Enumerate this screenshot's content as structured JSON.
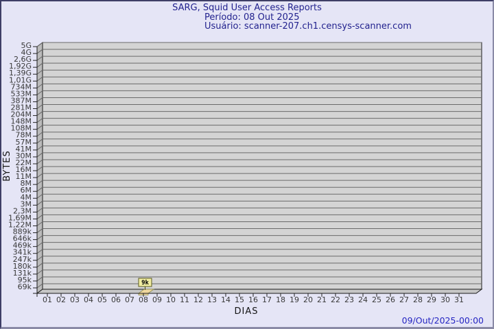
{
  "header": {
    "title": "SARG, Squid User Access Reports",
    "period": "Período: 08 Out 2025",
    "user": "Usuário: scanner-207.ch1.censys-scanner.com"
  },
  "footer": {
    "timestamp": "09/Out/2025-00:00"
  },
  "chart_data": {
    "type": "bar",
    "title": "SARG, Squid User Access Reports",
    "subtitle": "Período: 08 Out 2025 — Usuário: scanner-207.ch1.censys-scanner.com",
    "xlabel": "DIAS",
    "ylabel": "BYTES",
    "x_categories": [
      "01",
      "02",
      "03",
      "04",
      "05",
      "06",
      "07",
      "08",
      "09",
      "10",
      "11",
      "12",
      "13",
      "14",
      "15",
      "16",
      "17",
      "18",
      "19",
      "20",
      "21",
      "22",
      "23",
      "24",
      "25",
      "26",
      "27",
      "28",
      "29",
      "30",
      "31"
    ],
    "y_tick_labels": [
      "5G",
      "4G",
      "2,6G",
      "1,92G",
      "1,39G",
      "1,01G",
      "734M",
      "533M",
      "387M",
      "281M",
      "204M",
      "148M",
      "108M",
      "78M",
      "57M",
      "41M",
      "30M",
      "22M",
      "16M",
      "11M",
      "8M",
      "6M",
      "4M",
      "3M",
      "2,3M",
      "1,69M",
      "1,22M",
      "889k",
      "646k",
      "469k",
      "341k",
      "247k",
      "180k",
      "131k",
      "95k",
      "69k"
    ],
    "y_axis_range_labels": {
      "top": "5G",
      "bottom": "69k"
    },
    "series": [
      {
        "name": "bytes",
        "values": [
          0,
          0,
          0,
          0,
          0,
          0,
          0,
          9000,
          0,
          0,
          0,
          0,
          0,
          0,
          0,
          0,
          0,
          0,
          0,
          0,
          0,
          0,
          0,
          0,
          0,
          0,
          0,
          0,
          0,
          0,
          0
        ]
      }
    ],
    "annotations": [
      {
        "category": "08",
        "label": "9k",
        "value": 9000
      }
    ],
    "legend": null,
    "grid": "horizontal-only",
    "style": "3d-box",
    "colors": {
      "background": "#e5e5f6",
      "plot_face": "#d4d4d4",
      "wall": "#bbbbbb",
      "floor": "#c6c6c6",
      "grid": "#6a6a6a",
      "bar": "#efd79e",
      "bar_border": "#8e8e4e",
      "annotation_bg": "#f1eda1",
      "annotation_border": "#5c5c20",
      "title_text": "#22228e",
      "timestamp_text": "#2424c2"
    }
  }
}
